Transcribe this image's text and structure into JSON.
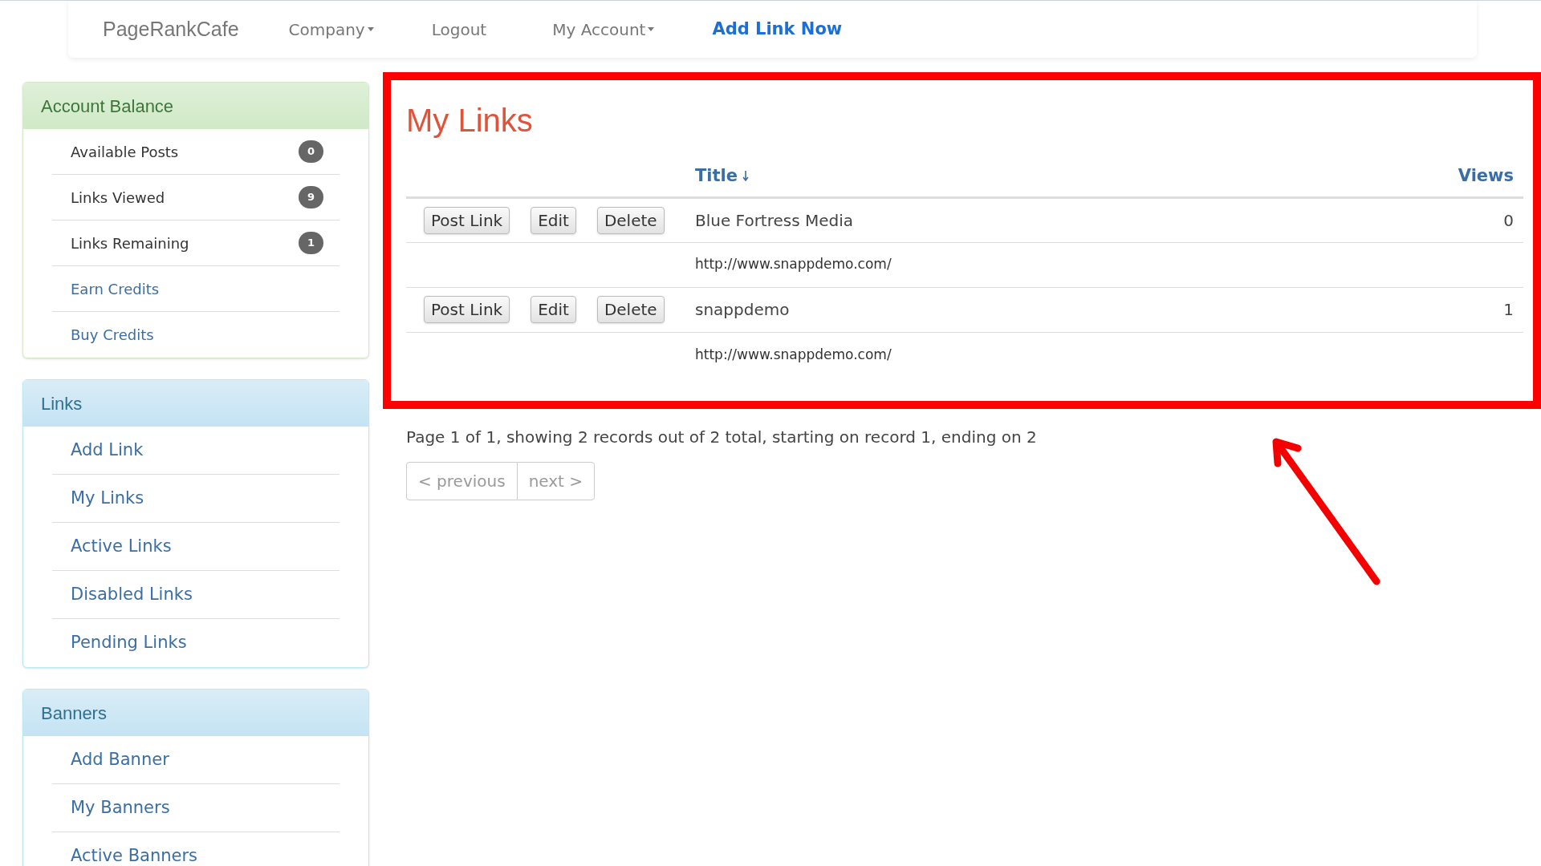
{
  "nav": {
    "brand": "PageRankCafe",
    "items": [
      {
        "label": "Company",
        "kind": "dropdown"
      },
      {
        "label": "Logout",
        "kind": "link"
      },
      {
        "label": "My Account",
        "kind": "dropdown"
      },
      {
        "label": "Add Link Now",
        "kind": "cta"
      }
    ]
  },
  "sidebar": {
    "panels": [
      {
        "title": "Account Balance",
        "kind": "success",
        "items": [
          {
            "label": "Available Posts",
            "kind": "stat",
            "badge": "0"
          },
          {
            "label": "Links Viewed",
            "kind": "stat",
            "badge": "9"
          },
          {
            "label": "Links Remaining",
            "kind": "stat",
            "badge": "1"
          },
          {
            "label": "Earn Credits",
            "kind": "link"
          },
          {
            "label": "Buy Credits",
            "kind": "link"
          }
        ]
      },
      {
        "title": "Links",
        "kind": "info",
        "items": [
          {
            "label": "Add Link",
            "kind": "link"
          },
          {
            "label": "My Links",
            "kind": "link"
          },
          {
            "label": "Active Links",
            "kind": "link"
          },
          {
            "label": "Disabled Links",
            "kind": "link"
          },
          {
            "label": "Pending Links",
            "kind": "link"
          }
        ]
      },
      {
        "title": "Banners",
        "kind": "info",
        "items": [
          {
            "label": "Add Banner",
            "kind": "link"
          },
          {
            "label": "My Banners",
            "kind": "link"
          },
          {
            "label": "Active Banners",
            "kind": "link"
          }
        ]
      }
    ]
  },
  "main": {
    "title": "My Links",
    "columns": [
      {
        "label": "Title",
        "sorted": true
      },
      {
        "label": "Views",
        "sorted": false
      }
    ],
    "rows": [
      {
        "actions": [
          "Post Link",
          "Edit",
          "Delete"
        ],
        "title": "Blue Fortress Media",
        "url": "http://www.snappdemo.com/",
        "views": "0"
      },
      {
        "actions": [
          "Post Link",
          "Edit",
          "Delete"
        ],
        "title": "snappdemo",
        "url": "http://www.snappdemo.com/",
        "views": "1"
      }
    ],
    "summary": "Page 1 of 1, showing 2 records out of 2 total, starting on record 1, ending on 2",
    "pagination": [
      {
        "label": "< previous",
        "disabled": true
      },
      {
        "label": "next >",
        "disabled": true
      }
    ]
  }
}
